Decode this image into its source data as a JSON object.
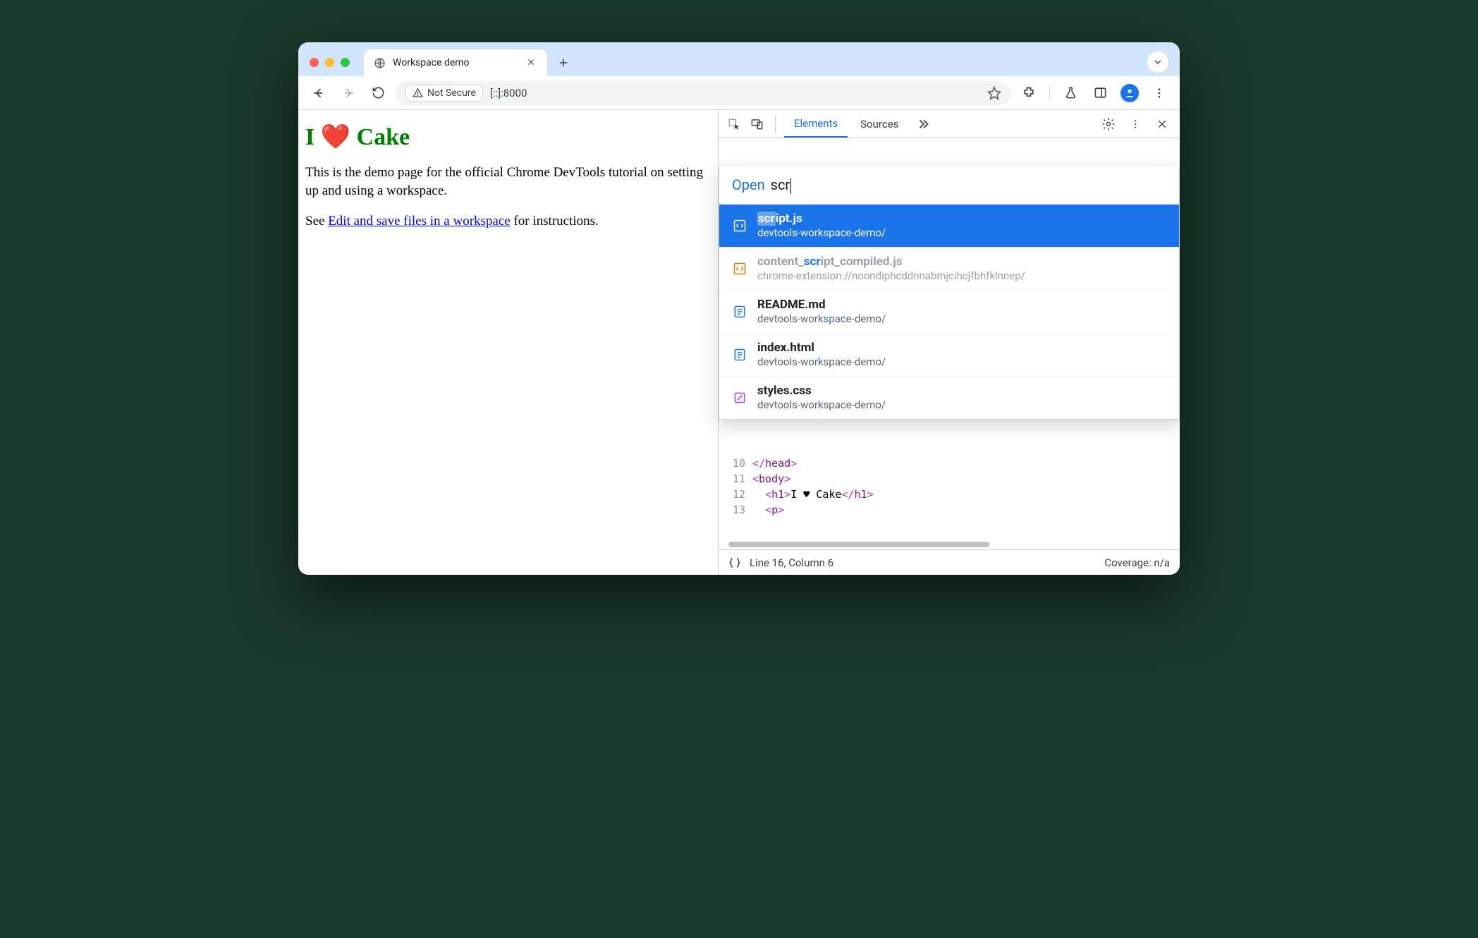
{
  "window": {
    "tab_title": "Workspace demo"
  },
  "toolbar": {
    "security_label": "Not Secure",
    "url": "[::]:8000"
  },
  "page": {
    "heading": "I ❤️ Cake",
    "para": "This is the demo page for the official Chrome DevTools tutorial on setting up and using a workspace.",
    "see_prefix": "See ",
    "link_text": "Edit and save files in a workspace",
    "see_suffix": " for instructions."
  },
  "devtools": {
    "tabs": {
      "elements": "Elements",
      "sources": "Sources"
    },
    "more_label": "",
    "status": {
      "line_col": "Line 16, Column 6",
      "coverage": "Coverage: n/a"
    },
    "code": {
      "l10": {
        "num": "10",
        "html": "<span class='tag-ang'>&lt;/</span><span class='tag-name'>head</span><span class='tag-ang'>&gt;</span>"
      },
      "l11": {
        "num": "11",
        "html": "<span class='tag-ang'>&lt;</span><span class='tag-name'>body</span><span class='tag-ang'>&gt;</span>"
      },
      "l12": {
        "num": "12",
        "html": "  <span class='tag-ang'>&lt;</span><span class='tag-name'>h1</span><span class='tag-ang'>&gt;</span><span class='txt'>I ♥ Cake</span><span class='tag-ang'>&lt;/</span><span class='tag-name'>h1</span><span class='tag-ang'>&gt;</span>"
      },
      "l13": {
        "num": "13",
        "html": "  <span class='tag-ang'>&lt;</span><span class='tag-name'>p</span><span class='tag-ang'>&gt;</span>"
      }
    }
  },
  "cmd": {
    "open_label": "Open",
    "query": "scr",
    "items": [
      {
        "name_html": "<span class='sel-hl'>scr</span>ipt.js",
        "path_html": "devtools-workspace-demo/",
        "kind": "js",
        "state": "selected"
      },
      {
        "name_html": "content_<span class='hl-blue'>scr</span>ipt_compiled.js",
        "path_html": "chrome-extension://noondiphcddnnabmjcihcjfbhfklnnep/",
        "kind": "snippet",
        "state": "dim"
      },
      {
        "name_html": "README.md",
        "path_html": "devtools-work<span class='hl-blue'>s</span>pa<span class='hl-blue'>c</span>e-demo/",
        "kind": "doc",
        "state": ""
      },
      {
        "name_html": "index.html",
        "path_html": "devtools-wo<span class='hl-blue'>r</span>kspace-demo/",
        "kind": "doc",
        "state": ""
      },
      {
        "name_html": "styles.css",
        "path_html": "devtools-wo<span class='hl-blue'>r</span>kspace-demo/",
        "kind": "css",
        "state": ""
      }
    ]
  }
}
